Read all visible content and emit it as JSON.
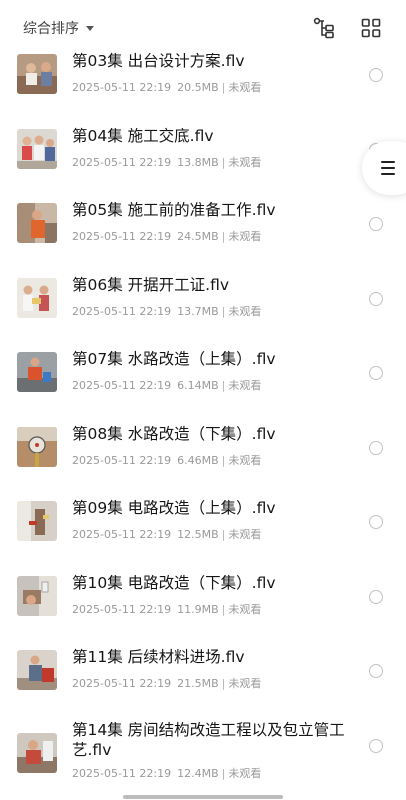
{
  "header": {
    "sort_label": "综合排序"
  },
  "items": [
    {
      "title": "第03集 出台设计方案.flv",
      "date": "2025-05-11 22:19",
      "size": "20.5MB",
      "status": "未观看"
    },
    {
      "title": "第04集 施工交底.flv",
      "date": "2025-05-11 22:19",
      "size": "13.8MB",
      "status": "未观看"
    },
    {
      "title": "第05集 施工前的准备工作.flv",
      "date": "2025-05-11 22:19",
      "size": "24.5MB",
      "status": "未观看"
    },
    {
      "title": "第06集 开据开工证.flv",
      "date": "2025-05-11 22:19",
      "size": "13.7MB",
      "status": "未观看"
    },
    {
      "title": "第07集 水路改造（上集）.flv",
      "date": "2025-05-11 22:19",
      "size": "6.14MB",
      "status": "未观看"
    },
    {
      "title": "第08集 水路改造（下集）.flv",
      "date": "2025-05-11 22:19",
      "size": "6.46MB",
      "status": "未观看"
    },
    {
      "title": "第09集 电路改造（上集）.flv",
      "date": "2025-05-11 22:19",
      "size": "12.5MB",
      "status": "未观看"
    },
    {
      "title": "第10集 电路改造（下集）.flv",
      "date": "2025-05-11 22:19",
      "size": "11.9MB",
      "status": "未观看"
    },
    {
      "title": "第11集 后续材料进场.flv",
      "date": "2025-05-11 22:19",
      "size": "21.5MB",
      "status": "未观看"
    },
    {
      "title": "第14集 房间结构改造工程以及包立管工艺.flv",
      "date": "2025-05-11 22:19",
      "size": "12.4MB",
      "status": "未观看"
    }
  ],
  "icons": {
    "sort_caret": "caret-down-icon",
    "tree_view": "tree-view-icon",
    "grid_view": "grid-view-icon",
    "side_menu": "menu-icon",
    "select": "radio-circle-icon"
  },
  "colors": {
    "text": "#161616",
    "meta": "#9a9a9a",
    "background": "#ffffff"
  }
}
